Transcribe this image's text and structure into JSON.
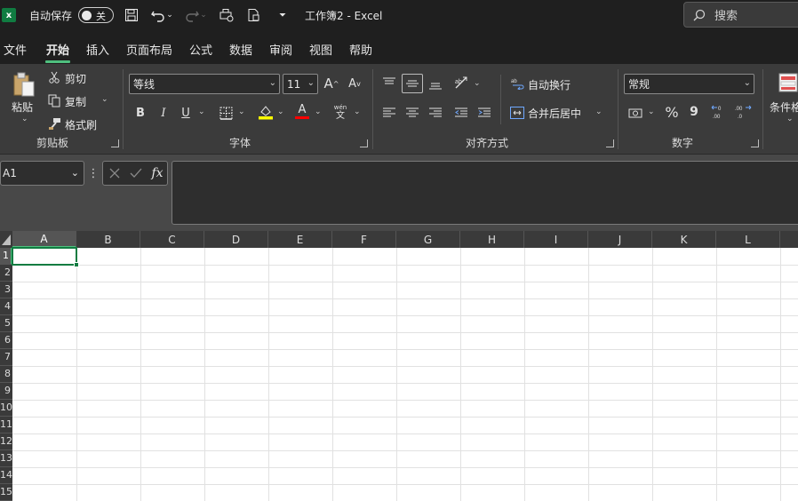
{
  "titlebar": {
    "app_icon": "excel-logo-icon",
    "app_letter": "x",
    "autosave_label": "自动保存",
    "autosave_state": "关",
    "doc_title": "工作簿2  -  Excel",
    "search_placeholder": "搜索"
  },
  "tabs": [
    "文件",
    "开始",
    "插入",
    "页面布局",
    "公式",
    "数据",
    "审阅",
    "视图",
    "帮助"
  ],
  "active_tab": "开始",
  "ribbon": {
    "clipboard": {
      "paste": "粘贴",
      "cut": "剪切",
      "copy": "复制",
      "format_painter": "格式刷",
      "group_label": "剪贴板"
    },
    "font": {
      "font_name": "等线",
      "font_size": "11",
      "grow": "A",
      "shrink": "A",
      "bold": "B",
      "italic": "I",
      "underline": "U",
      "font_color_letter": "A",
      "phonetic_top": "wén",
      "phonetic_bottom": "文",
      "group_label": "字体"
    },
    "alignment": {
      "wrap_text": "自动换行",
      "merge_center": "合并后居中",
      "group_label": "对齐方式"
    },
    "number": {
      "format": "常规",
      "percent": "%",
      "comma": "9",
      "group_label": "数字"
    },
    "styles": {
      "conditional": "条件格"
    }
  },
  "formula_bar": {
    "name_box": "A1",
    "fx": "fx",
    "formula": ""
  },
  "grid": {
    "columns": [
      "A",
      "B",
      "C",
      "D",
      "E",
      "F",
      "G",
      "H",
      "I",
      "J",
      "K",
      "L"
    ],
    "rows": [
      "1",
      "2",
      "3",
      "4",
      "5",
      "6",
      "7",
      "8",
      "9",
      "10",
      "11",
      "12",
      "13",
      "14",
      "15"
    ],
    "active_cell": "A1"
  },
  "colors": {
    "accent": "#107c41",
    "highlight_yellow": "#ffff00",
    "font_red": "#ff0000"
  }
}
